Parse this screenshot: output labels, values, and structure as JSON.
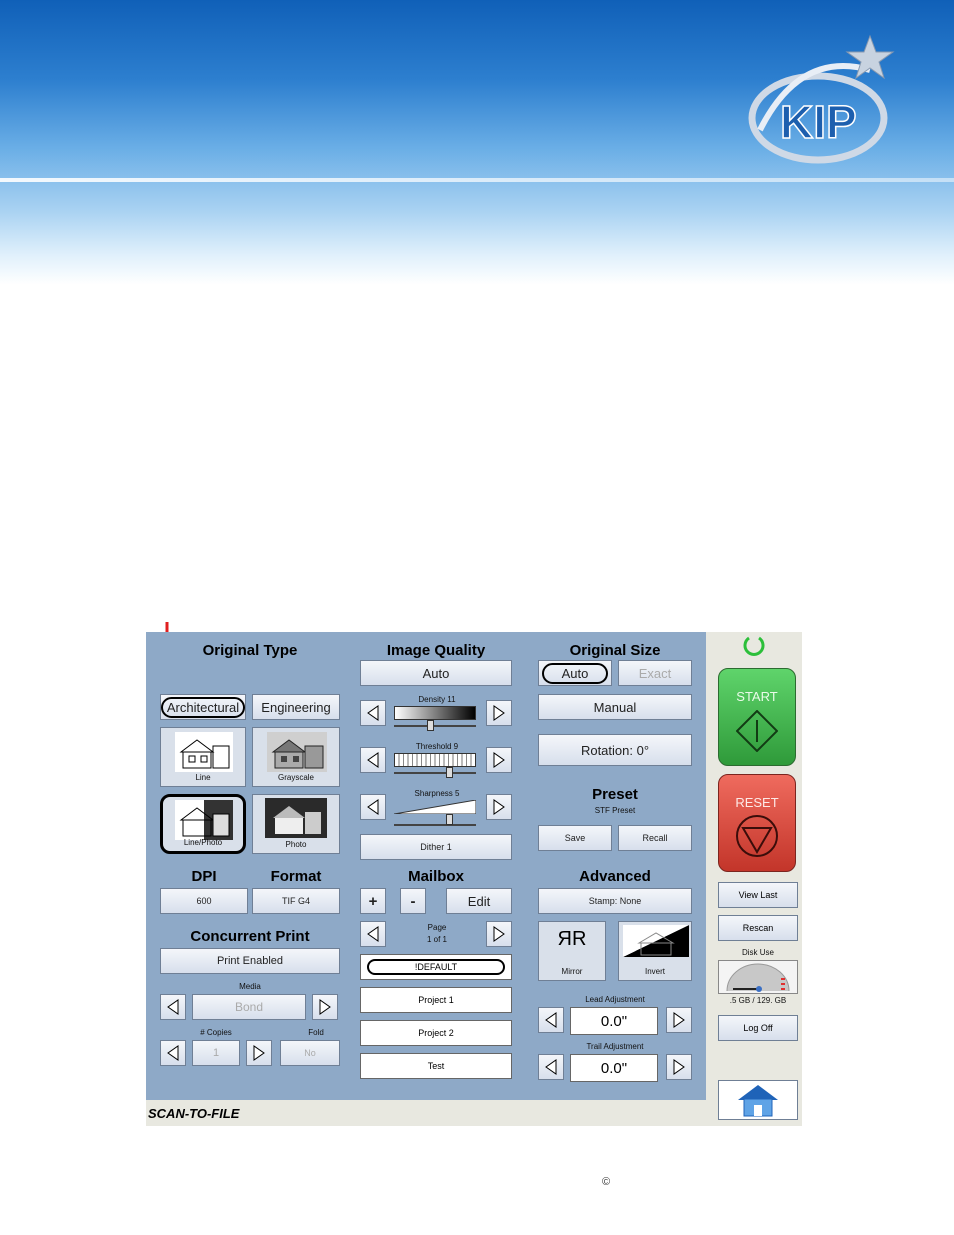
{
  "brand": {
    "logo_text": "KIP"
  },
  "app": {
    "mode_label": "SCAN-TO-FILE"
  },
  "original_type": {
    "heading": "Original Type",
    "architectural": "Architectural",
    "engineering": "Engineering",
    "line": "Line",
    "grayscale": "Grayscale",
    "line_photo": "Line/Photo",
    "photo": "Photo"
  },
  "image_quality": {
    "heading": "Image Quality",
    "auto": "Auto",
    "density": "Density 11",
    "threshold": "Threshold 9",
    "sharpness": "Sharpness 5",
    "dither": "Dither 1"
  },
  "original_size": {
    "heading": "Original Size",
    "auto": "Auto",
    "exact": "Exact",
    "manual": "Manual",
    "rotation": "Rotation: 0°"
  },
  "preset": {
    "heading": "Preset",
    "name": "STF Preset",
    "save": "Save",
    "recall": "Recall"
  },
  "dpi": {
    "heading": "DPI",
    "value": "600"
  },
  "format": {
    "heading": "Format",
    "value": "TIF G4"
  },
  "mailbox": {
    "heading": "Mailbox",
    "plus": "+",
    "minus": "-",
    "edit": "Edit",
    "page_label": "Page",
    "page_value": "1 of 1",
    "items": [
      "!DEFAULT",
      "Project 1",
      "Project 2",
      "Test"
    ]
  },
  "advanced": {
    "heading": "Advanced",
    "stamp": "Stamp: None",
    "mirror": "Mirror",
    "invert": "Invert",
    "lead_label": "Lead Adjustment",
    "lead_value": "0.0\"",
    "trail_label": "Trail Adjustment",
    "trail_value": "0.0\""
  },
  "concurrent_print": {
    "heading": "Concurrent Print",
    "status": "Print Enabled",
    "media_label": "Media",
    "media_value": "Bond",
    "copies_label": "# Copies",
    "copies_value": "1",
    "fold_label": "Fold",
    "fold_value": "No"
  },
  "side": {
    "start": "START",
    "reset": "RESET",
    "view_last": "View Last",
    "rescan": "Rescan",
    "disk_use": "Disk Use",
    "disk_value": ".5 GB / 129. GB",
    "log_off": "Log Off"
  },
  "footer": {
    "copyright": "©"
  },
  "colors": {
    "panel": "#8ea9c7",
    "start": "#3fae48",
    "reset": "#d9483b",
    "arrow": "#e02020"
  }
}
